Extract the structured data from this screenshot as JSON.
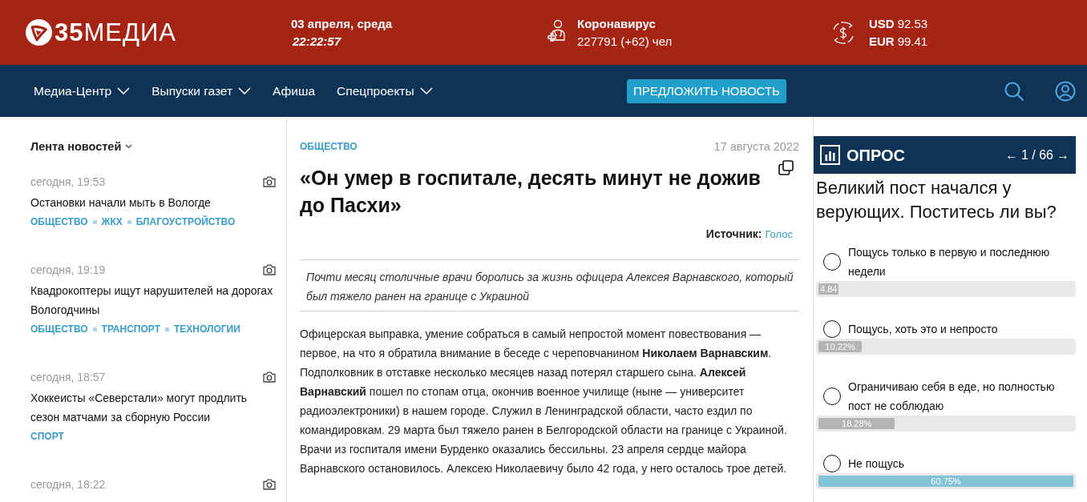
{
  "header": {
    "logo": "**35**МЕДИА",
    "date": "03 апреля, среда",
    "time": "22:22:57",
    "covid": {
      "title": "Коронавирус",
      "count": "227791 (+62) чел"
    },
    "currency": [
      {
        "code": "USD",
        "rate": "92.53"
      },
      {
        "code": "EUR",
        "rate": "99.41"
      }
    ]
  },
  "nav": {
    "items": [
      {
        "label": "Медиа-Центр",
        "dropdown": true
      },
      {
        "label": "Выпуски газет",
        "dropdown": true
      },
      {
        "label": "Афиша",
        "dropdown": false
      },
      {
        "label": "Спецпроекты",
        "dropdown": true
      }
    ],
    "suggest_button": "ПРЕДЛОЖИТЬ НОВОСТЬ"
  },
  "news_feed": {
    "title": "Лента новостей",
    "items": [
      {
        "time": "сегодня, 19:53",
        "title": "Остановки начали мыть в Вологде",
        "tags": [
          "ОБЩЕСТВО",
          "ЖКХ",
          "БЛАГОУСТРОЙСТВО"
        ]
      },
      {
        "time": "сегодня, 19:19",
        "title": "Квадрокоптеры ищут нарушителей на дорогах Вологодчины",
        "tags": [
          "ОБЩЕСТВО",
          "ТРАНСПОРТ",
          "ТЕХНОЛОГИИ"
        ]
      },
      {
        "time": "сегодня, 18:57",
        "title": "Хоккеисты «Северстали» могут продлить сезон матчами за сборную России",
        "tags": [
          "СПОРТ"
        ]
      },
      {
        "time": "сегодня, 18:22"
      }
    ]
  },
  "article": {
    "rubric": "ОБЩЕСТВО",
    "date": "17 августа 2022",
    "title": "«Он умер в госпитале, десять минут не дожив до Пасхи»",
    "source_label": "Источник:",
    "source": "Голос",
    "lead": "Почти месяц столичные врачи боролись за жизнь офицера Алексея Варнавского, который был тяжело ранен на границе с Украиной",
    "body": "Офицерская выправка, умение собраться в самый непростой момент повествования — первое, на что я обратила внимание в беседе с череповчанином **Николаем Варнавским**. Подполковник в отставке несколько месяцев назад потерял старшего сына. **Алексей Варнавский** пошел по стопам отца, окончив военное училище (ныне — университет радиоэлектроники) в нашем городе. Служил в Ленинградской области, часто ездил по командировкам. 29 марта был тяжело ранен в Белгородской области на границе с Украиной. Врачи из госпиталя имени Бурденко оказались бессильны. 23 апреля сердце майора Варнавского остановилось. Алексею Николаевичу было 42 года, у него осталось трое детей."
  },
  "poll": {
    "title": "ОПРОС",
    "pager": {
      "prev": "←",
      "counter": "1 / 66",
      "next": "→"
    },
    "question": "Великий пост начался у верующих. Поститесь ли вы?",
    "options": [
      {
        "label": "Пощусь только в первую и последнюю недели",
        "selected": false,
        "level": 0.08,
        "percent": "4.84",
        "leading": false
      },
      {
        "label": "Пощусь, хоть это и непросто",
        "selected": false,
        "level": 0.17,
        "percent": "10.22%",
        "leading": false
      },
      {
        "label": "Ограничиваю себя в еде, но полностью пост не соблюдаю",
        "selected": false,
        "level": 0.3,
        "percent": "18.28%",
        "leading": false
      },
      {
        "label": "Не пощусь",
        "selected": false,
        "level": 1,
        "percent": "60.75%",
        "leading": true
      }
    ]
  }
}
